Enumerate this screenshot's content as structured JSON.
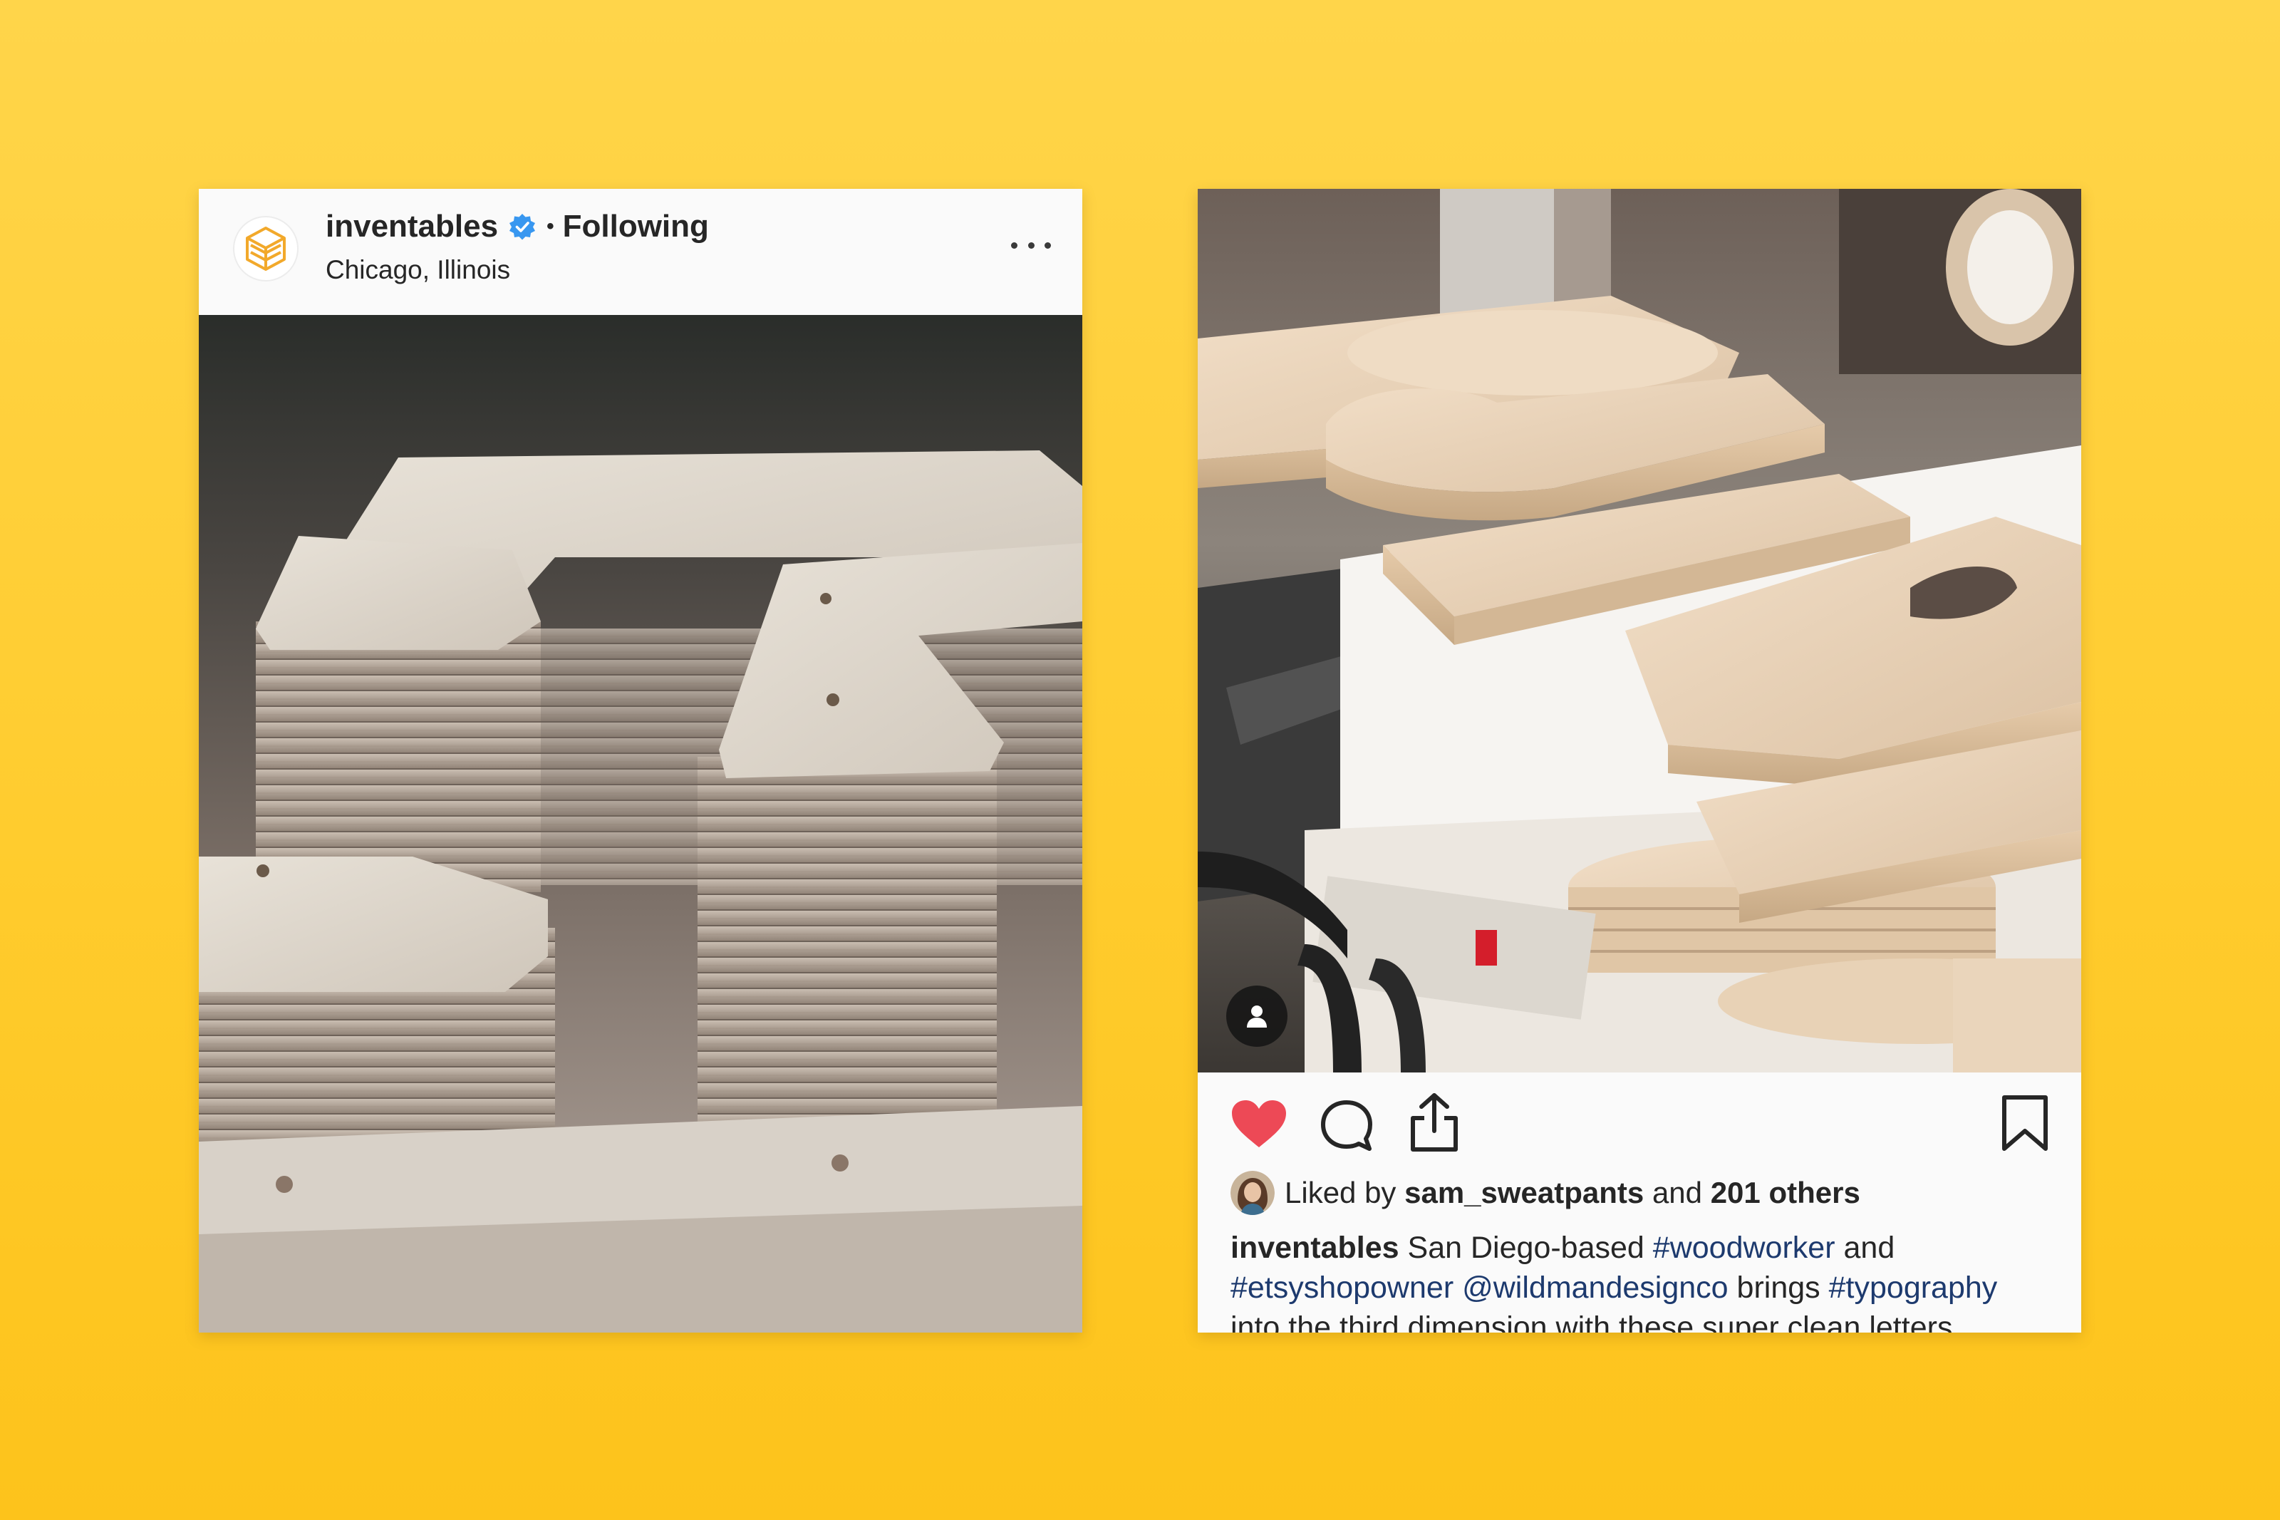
{
  "left_post": {
    "username": "inventables",
    "separator": "•",
    "follow_status": "Following",
    "location": "Chicago, Illinois",
    "photo_icon": "stacked-plywood-bracket-photo"
  },
  "right_post": {
    "photo_icon": "stacked-wooden-letters-photo",
    "liked_prefix": "Liked by",
    "liker": "sam_sweatpants",
    "liked_join": "and",
    "likes_count": "201 others",
    "caption": {
      "username": "inventables",
      "t1": "San Diego-based",
      "tag1": "#woodworker",
      "t2": "and",
      "tag2": "#etsyshopowner",
      "mention": "@wildmandesignco",
      "t3": "brings",
      "tag3": "#typography",
      "t4": "into the third dimension with these super clean letters"
    }
  },
  "colors": {
    "background": "#FFCC2E",
    "like_red": "#ED4956",
    "link_blue": "#1D3A6E",
    "verified_blue": "#3897F0"
  }
}
